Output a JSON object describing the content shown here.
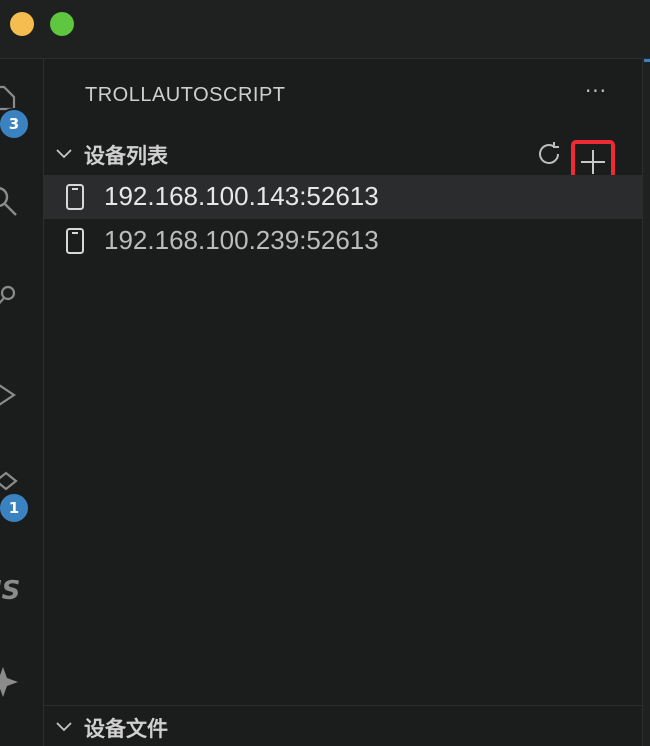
{
  "window": {
    "traffic_lights": [
      "yellow",
      "green"
    ]
  },
  "activity_bar": {
    "items": [
      {
        "icon": "explorer-icon",
        "badge": "3"
      },
      {
        "icon": "search-icon"
      },
      {
        "icon": "source-control-icon"
      },
      {
        "icon": "run-debug-icon"
      },
      {
        "icon": "extensions-icon",
        "badge": "1"
      },
      {
        "icon": "js-icon"
      },
      {
        "icon": "sparkle-icon"
      }
    ]
  },
  "sidebar": {
    "title": "TROLLAUTOSCRIPT",
    "more_label": "···",
    "device_section": {
      "label": "设备列表",
      "devices": [
        {
          "address": "192.168.100.143:52613",
          "selected": true
        },
        {
          "address": "192.168.100.239:52613",
          "selected": false
        }
      ]
    },
    "file_section": {
      "label": "设备文件"
    }
  },
  "colors": {
    "background": "#1b1c1c",
    "selected_row": "#2b2c2d",
    "badge": "#3b83c0",
    "highlight_box": "#ee2a35",
    "traffic_yellow": "#f5bd4f",
    "traffic_green": "#5fc73f"
  }
}
